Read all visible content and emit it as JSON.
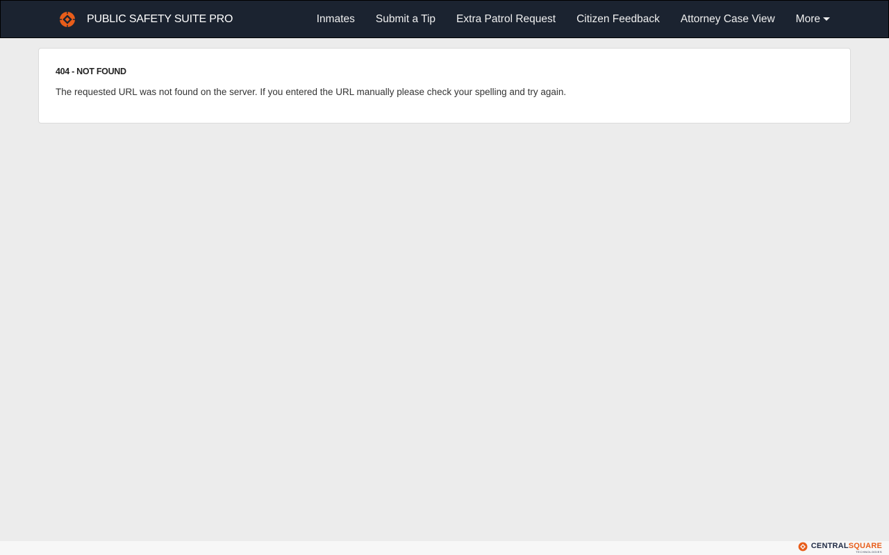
{
  "header": {
    "brand_name": "PUBLIC SAFETY SUITE PRO",
    "logo_icon": "centralsquare-logo-icon",
    "nav_items": [
      {
        "label": "Inmates"
      },
      {
        "label": "Submit a Tip"
      },
      {
        "label": "Extra Patrol Request"
      },
      {
        "label": "Citizen Feedback"
      },
      {
        "label": "Attorney Case View"
      }
    ],
    "more_label": "More",
    "colors": {
      "navbar_bg": "#1b2330",
      "accent": "#e85d1a"
    }
  },
  "main": {
    "error_title": "404 - NOT FOUND",
    "error_message": "The requested URL was not found on the server. If you entered the URL manually please check your spelling and try again."
  },
  "footer": {
    "logo_word_central": "CENTRAL",
    "logo_word_square": "SQUARE",
    "logo_sub": "TECHNOLOGIES"
  }
}
